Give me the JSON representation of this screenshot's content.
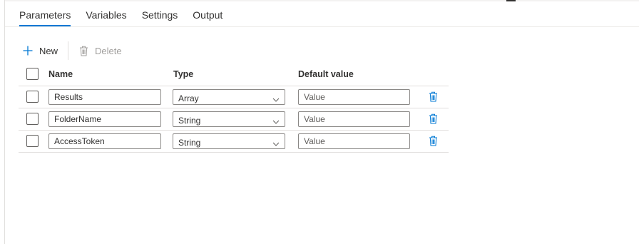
{
  "tabs": [
    {
      "label": "Parameters",
      "active": true
    },
    {
      "label": "Variables",
      "active": false
    },
    {
      "label": "Settings",
      "active": false
    },
    {
      "label": "Output",
      "active": false
    }
  ],
  "toolbar": {
    "new_label": "New",
    "delete_label": "Delete",
    "new_icon": "plus-icon",
    "delete_icon": "trash-icon"
  },
  "grid": {
    "columns": {
      "name": "Name",
      "type": "Type",
      "default_value": "Default value"
    },
    "rows": [
      {
        "name": "Results",
        "type": "Array",
        "default_placeholder": "Value"
      },
      {
        "name": "FolderName",
        "type": "String",
        "default_placeholder": "Value"
      },
      {
        "name": "AccessToken",
        "type": "String",
        "default_placeholder": "Value"
      }
    ]
  },
  "colors": {
    "accent": "#0078d4",
    "icon": "#0078d4",
    "disabled": "#a19f9d"
  }
}
